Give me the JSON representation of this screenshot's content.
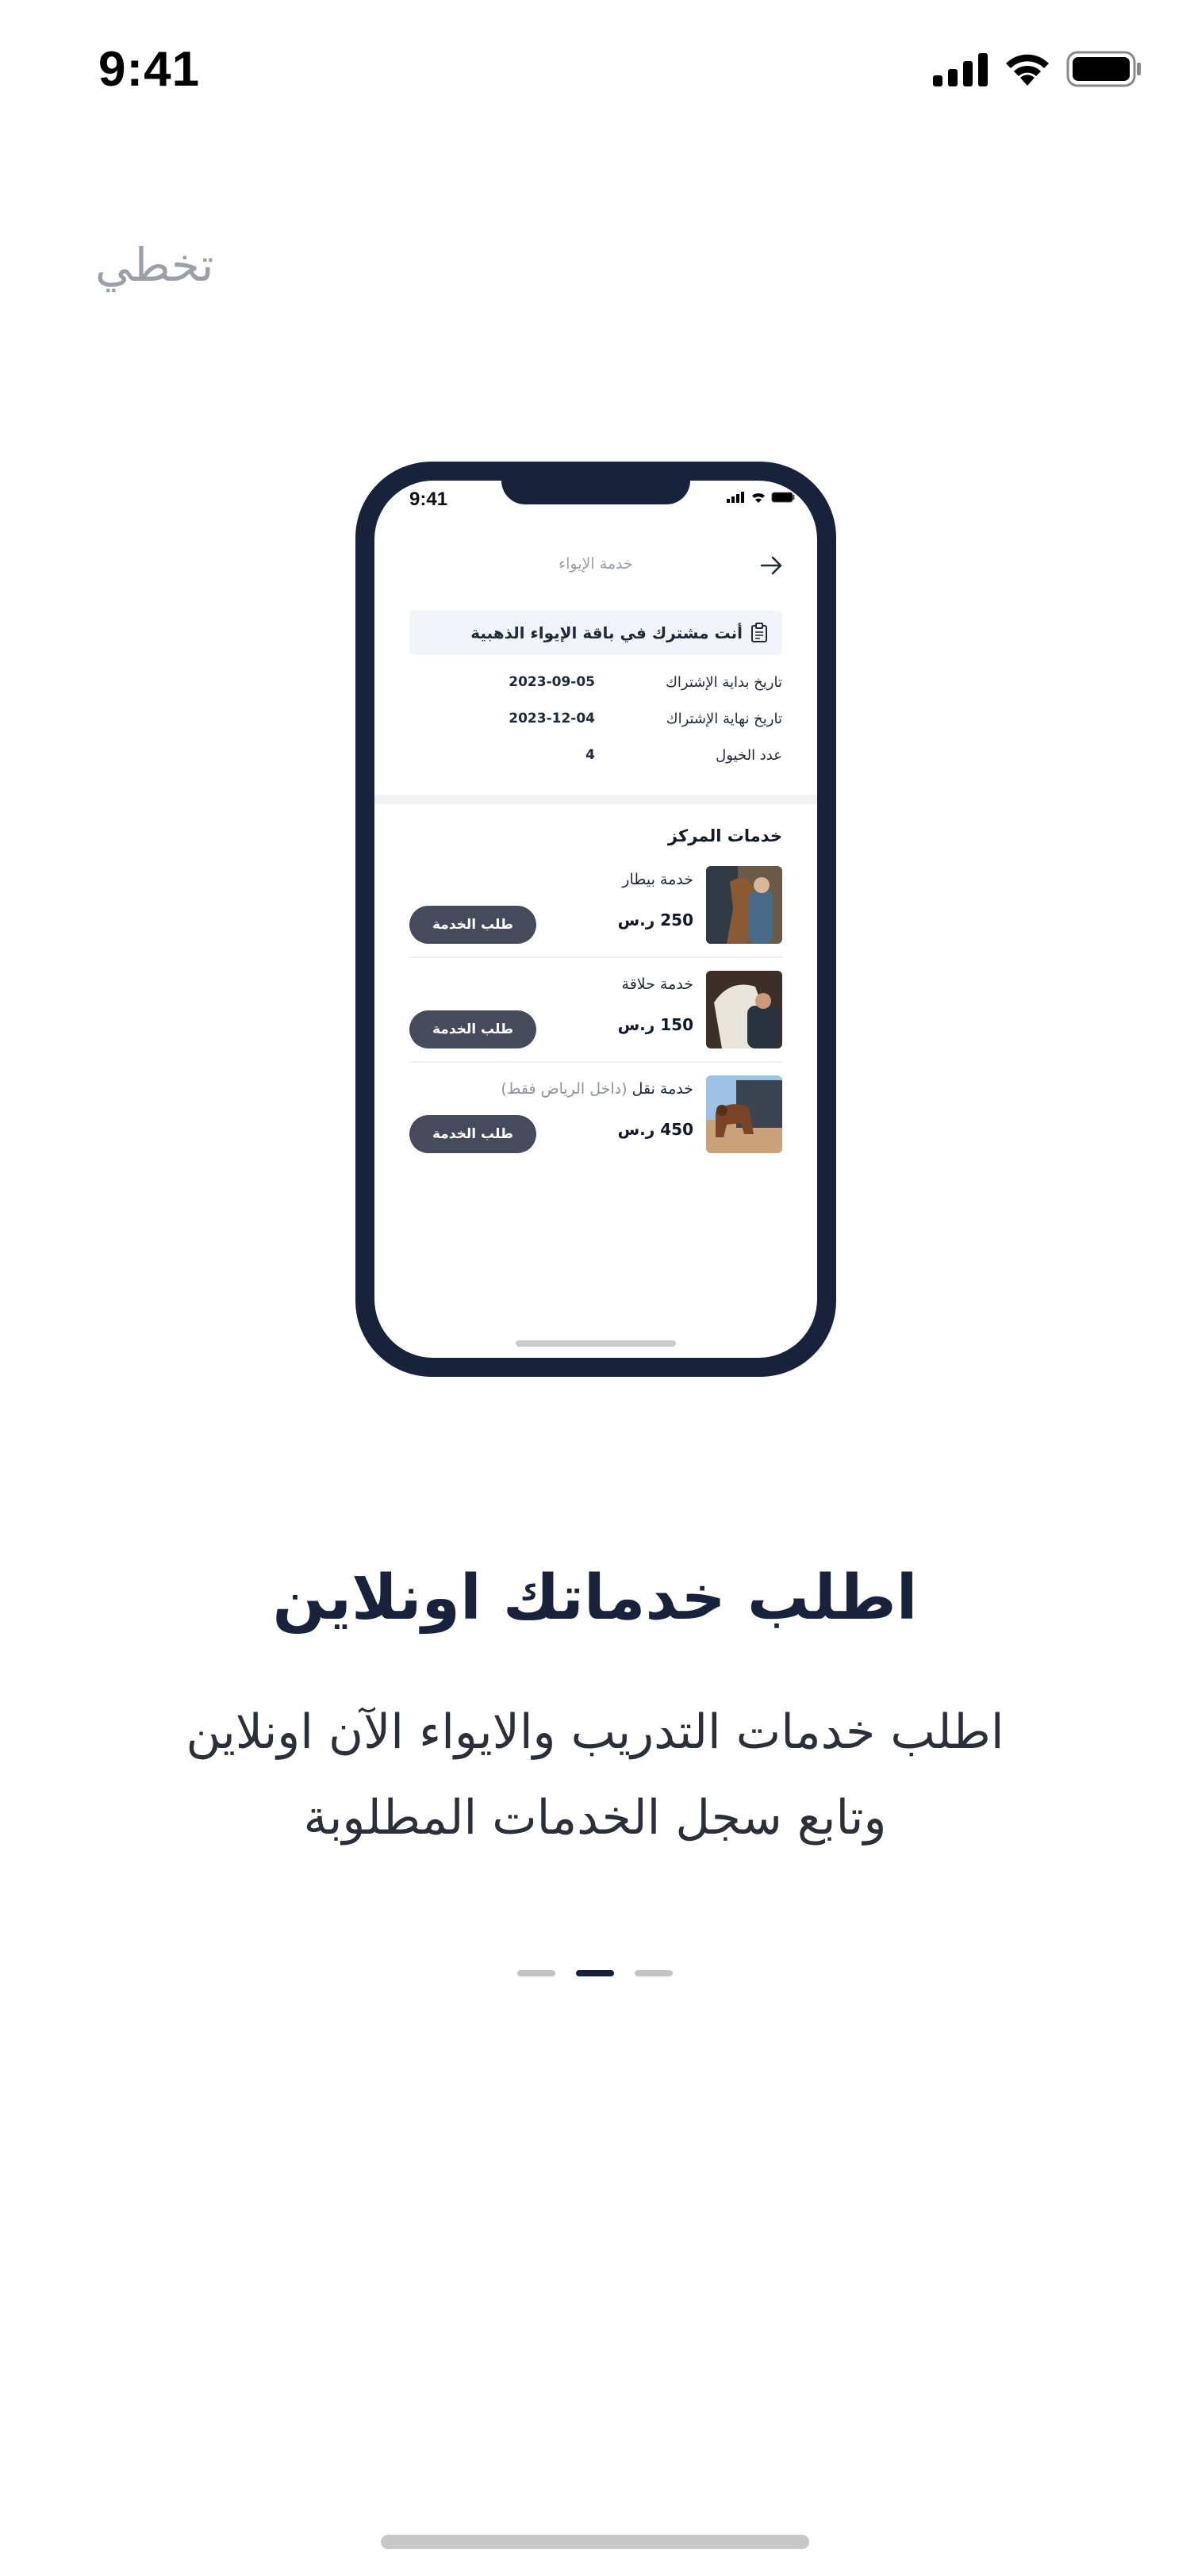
{
  "status_bar": {
    "time": "9:41"
  },
  "skip": {
    "label": "تخطي"
  },
  "mockup": {
    "status_time": "9:41",
    "header_title": "خدمة الإيواء",
    "subscription_text": "أنت مشترك في باقة الإيواء الذهبية",
    "info_rows": [
      {
        "label": "تاريخ بداية الإشتراك",
        "value": "2023-09-05"
      },
      {
        "label": "تاريخ نهاية الإشتراك",
        "value": "2023-12-04"
      },
      {
        "label": "عدد الخيول",
        "value": "4"
      }
    ],
    "section_title": "خدمات المركز",
    "services": [
      {
        "name": "خدمة بيطار",
        "note": "",
        "price": "250 ر.س",
        "button": "طلب الخدمة"
      },
      {
        "name": "خدمة حلاقة",
        "note": "",
        "price": "150 ر.س",
        "button": "طلب الخدمة"
      },
      {
        "name": "خدمة نقل",
        "note": "(داخل الرياض فقط)",
        "price": "450 ر.س",
        "button": "طلب الخدمة"
      }
    ]
  },
  "onboarding": {
    "title": "اطلب خدماتك اونلاين",
    "description_line1": "اطلب خدمات التدريب والايواء الآن اونلاين",
    "description_line2": "وتابع سجل الخدمات المطلوبة",
    "page_index": 2,
    "page_count": 3
  },
  "colors": {
    "primary": "#18223a",
    "button": "#454b5a",
    "muted": "#9aa0a6"
  }
}
